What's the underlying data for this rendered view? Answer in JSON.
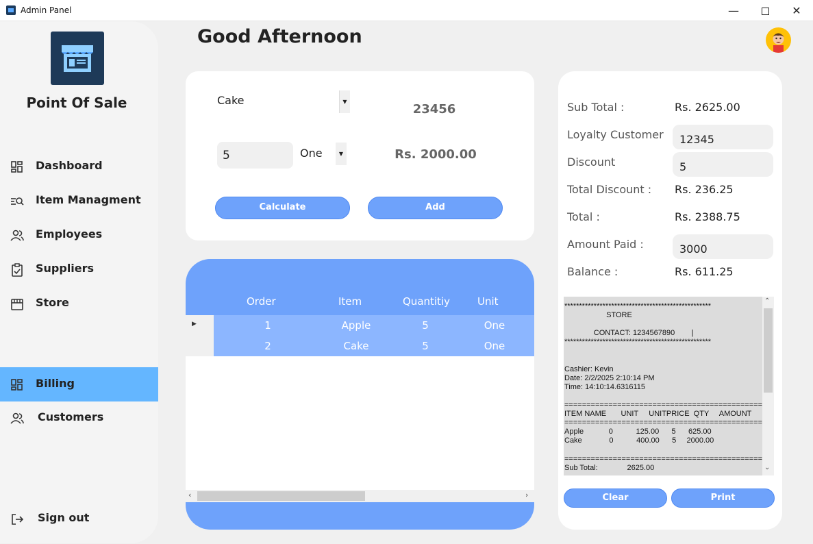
{
  "window": {
    "title": "Admin Panel",
    "minimize": "—",
    "close": "✕"
  },
  "sidebar": {
    "brand": "Point Of Sale",
    "items": [
      {
        "label": "Dashboard",
        "icon": "dashboard-icon"
      },
      {
        "label": "Item Managment",
        "icon": "item-search-icon"
      },
      {
        "label": "Employees",
        "icon": "users-icon"
      },
      {
        "label": "Suppliers",
        "icon": "clipboard-check-icon"
      },
      {
        "label": "Store",
        "icon": "store-icon"
      },
      {
        "label": "Billing",
        "icon": "dashboard-icon",
        "active": true
      },
      {
        "label": "Customers",
        "icon": "users-icon"
      },
      {
        "label": "Sign out",
        "icon": "sign-out-icon"
      }
    ]
  },
  "header": {
    "greeting": "Good Afternoon"
  },
  "entry": {
    "item": "Cake",
    "item_code": "23456",
    "quantity": "5",
    "unit": "One",
    "price": "Rs. 2000.00",
    "calculate_label": "Calculate",
    "add_label": "Add"
  },
  "table": {
    "columns": [
      "Order",
      "Item",
      "Quantitiy",
      "Unit"
    ],
    "rows": [
      {
        "order": "1",
        "item": "Apple",
        "quantity": "5",
        "unit": "One"
      },
      {
        "order": "2",
        "item": "Cake",
        "quantity": "5",
        "unit": "One"
      }
    ]
  },
  "summary": {
    "sub_total_label": "Sub Total :",
    "sub_total": "Rs. 2625.00",
    "loyalty_label": "Loyalty Customer",
    "loyalty_value": "12345",
    "discount_label": "Discount",
    "discount_value": "5",
    "total_discount_label": "Total Discount :",
    "total_discount": "Rs. 236.25",
    "total_label": "Total :",
    "total": "Rs. 2388.75",
    "amount_paid_label": "Amount Paid :",
    "amount_paid": "3000",
    "balance_label": "Balance :",
    "balance": "Rs. 611.25"
  },
  "receipt": {
    "text": "**************************************************\n                    STORE\n\n              CONTACT: 1234567890        |\n**************************************************\n\n\nCashier: Kevin\nDate: 2/2/2025 2:10:14 PM\nTime: 14:10:14.6316115\n\n==============================================\nITEM NAME       UNIT     UNITPRICE  QTY     AMOUNT\n==============================================\nApple            0           125.00      5      625.00\nCake             0           400.00      5     2000.00\n\n==============================================\nSub Total:              2625.00",
    "clear_label": "Clear",
    "print_label": "Print"
  },
  "colors": {
    "accent": "#6ea2fb",
    "active_nav": "#64b6ff",
    "brand_box": "#1e3a58"
  }
}
